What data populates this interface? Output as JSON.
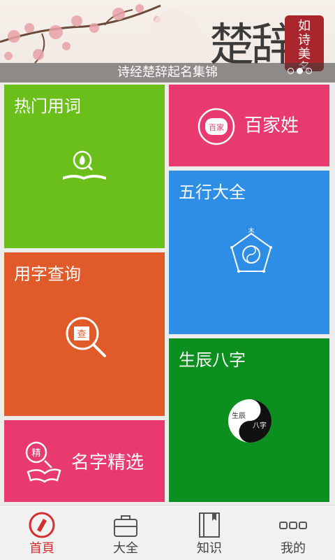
{
  "banner": {
    "caption": "诗经楚辞起名集锦",
    "calligraphy": "楚辞",
    "seal_text": "如诗美名",
    "slides": 3,
    "active_slide": 2
  },
  "tiles": {
    "hot": {
      "title": "热门用词",
      "icon": "book-fire-icon",
      "color": "#6bbf1a"
    },
    "surname": {
      "title": "百家姓",
      "icon_text": "百家",
      "color": "#e93a6f"
    },
    "wuxing": {
      "title": "五行大全",
      "icon_top": "木",
      "icon_center": "金",
      "color": "#2e8ee6"
    },
    "query": {
      "title": "用字查询",
      "icon_text": "查",
      "color": "#e15a2a"
    },
    "bazi": {
      "title": "生辰八字",
      "yin_text": "生辰",
      "yang_text": "八字",
      "color": "#0b901f"
    },
    "name": {
      "title": "名字精选",
      "icon_text": "精",
      "color": "#e93a6f"
    }
  },
  "nav": {
    "items": [
      {
        "label": "首頁",
        "icon": "home-icon",
        "active": true
      },
      {
        "label": "大全",
        "icon": "briefcase-icon",
        "active": false
      },
      {
        "label": "知识",
        "icon": "book-icon",
        "active": false
      },
      {
        "label": "我的",
        "icon": "more-icon",
        "active": false
      }
    ],
    "active_color": "#d32f2f"
  }
}
